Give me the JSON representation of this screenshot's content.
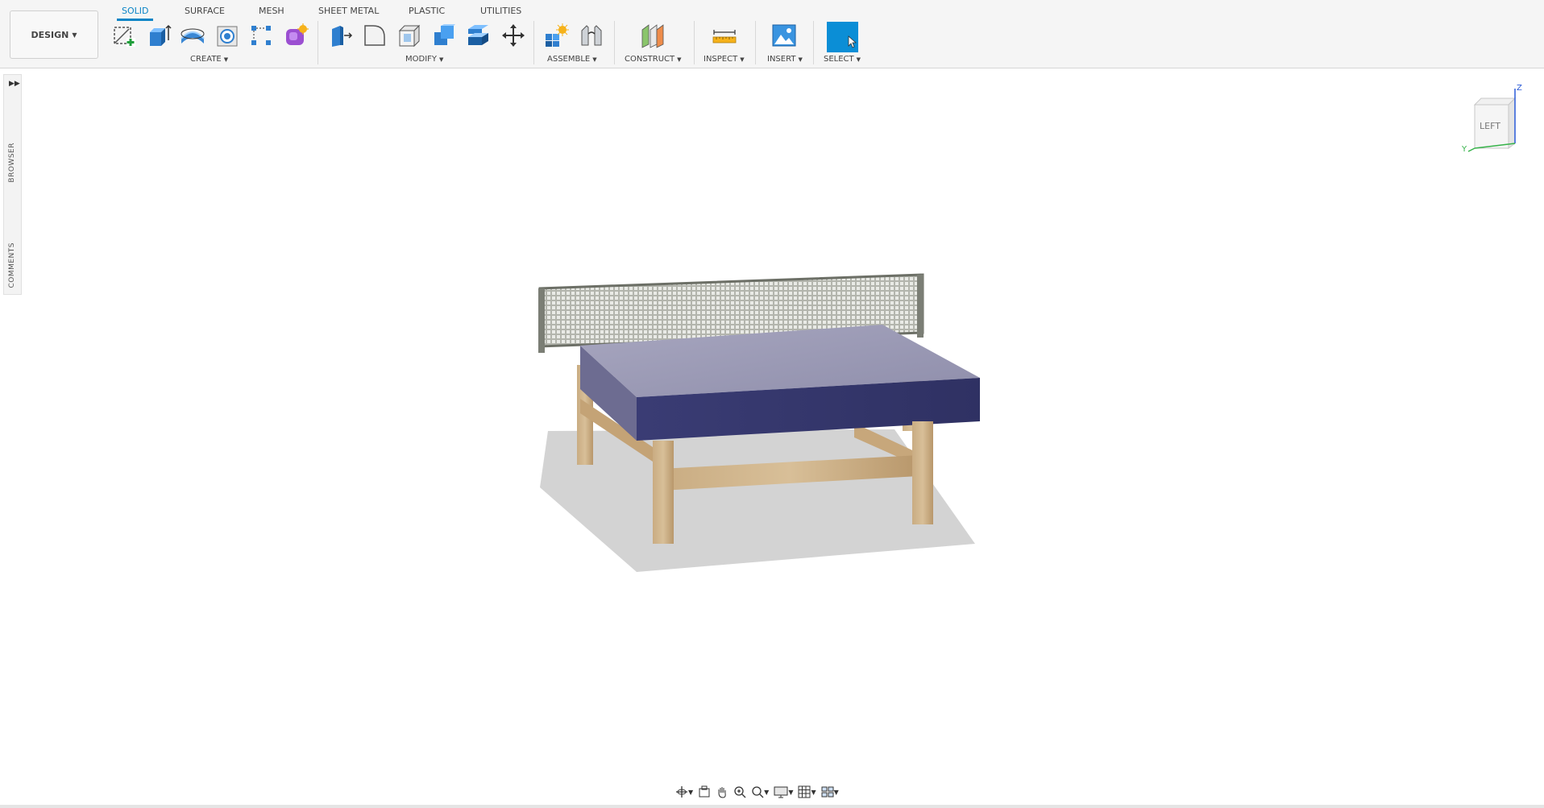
{
  "workspace": {
    "label": "DESIGN"
  },
  "tabs": [
    {
      "label": "SOLID",
      "active": true
    },
    {
      "label": "SURFACE"
    },
    {
      "label": "MESH"
    },
    {
      "label": "SHEET METAL"
    },
    {
      "label": "PLASTIC"
    },
    {
      "label": "UTILITIES"
    }
  ],
  "groups": {
    "create": "CREATE",
    "modify": "MODIFY",
    "assemble": "ASSEMBLE",
    "construct": "CONSTRUCT",
    "inspect": "INSPECT",
    "insert": "INSERT",
    "select": "SELECT"
  },
  "side_panel": {
    "browser": "BROWSER",
    "comments": "COMMENTS"
  },
  "viewcube": {
    "face": "LEFT",
    "axis_z": "Z",
    "axis_y": "Y"
  },
  "colors": {
    "accent": "#0a84c6",
    "select_active": "#0b8ed6",
    "table_top": "#9a99b3",
    "table_side": "#37396b",
    "wood": "#c9a87c",
    "net": "#8c8f86"
  },
  "icons": [
    "sketch-icon",
    "extrude-icon",
    "revolve-icon",
    "hole-icon",
    "pattern-icon",
    "form-icon",
    "press-pull-icon",
    "fillet-icon",
    "shell-icon",
    "combine-icon",
    "offset-face-icon",
    "move-icon",
    "new-component-icon",
    "joint-icon",
    "offset-plane-icon",
    "measure-icon",
    "insert-image-icon",
    "orbit-icon",
    "look-at-icon",
    "pan-icon",
    "zoom-icon",
    "fit-icon",
    "display-settings-icon",
    "grid-icon",
    "viewports-icon"
  ]
}
